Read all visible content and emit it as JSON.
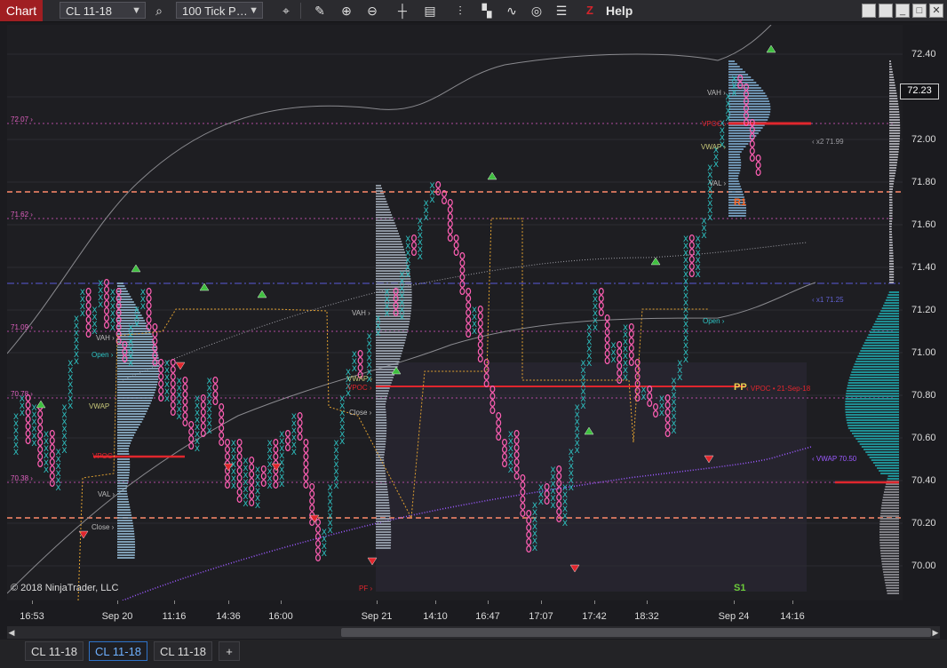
{
  "toolbar": {
    "chart_tab": "Chart",
    "instrument": "CL 11-18",
    "interval": "100 Tick P…",
    "help": "Help",
    "logo_letter": "Z",
    "icons": [
      "search-icon",
      "data-box-icon",
      "pencil-icon",
      "zoom-in-icon",
      "zoom-out-icon",
      "crosshair-icon",
      "chart-properties-icon",
      "bar-type-icon",
      "templates-icon",
      "indicators-icon",
      "strategies-icon",
      "object-list-icon"
    ]
  },
  "window_buttons": [
    "restore-icon",
    "tile-icon",
    "minimize-icon",
    "maximize-icon",
    "close-icon"
  ],
  "chart": {
    "copyright": "© 2018 NinjaTrader, LLC",
    "current_price": "72.23",
    "price_ticks": [
      "72.40",
      "72.20",
      "72.00",
      "71.80",
      "71.60",
      "71.40",
      "71.20",
      "71.00",
      "70.80",
      "70.60",
      "70.40",
      "70.20",
      "70.00"
    ],
    "time_ticks": [
      "16:53",
      "Sep 20",
      "11:16",
      "14:36",
      "16:00",
      "Sep 21",
      "14:10",
      "16:47",
      "17:07",
      "17:42",
      "18:32",
      "Sep 24",
      "14:16"
    ],
    "left_levels": [
      "72.07",
      "71.62",
      "71.09",
      "70.78",
      "70.38"
    ],
    "profile_labels": {
      "vah": "VAH",
      "open": "Open",
      "vwap": "VWAP",
      "vpoc": "VPOC",
      "val": "VAL",
      "close": "Close",
      "pf": "PF",
      "vpoc_naked": "VPOC • 21-Sep-18",
      "vwap_right": "VWAP 70.50",
      "x1": "x1 71.25",
      "x2": "x2 71.99"
    },
    "pivots": {
      "pp": "PP",
      "r1": "R1",
      "s1": "S1"
    },
    "colors": {
      "x": "#2ec4c4",
      "o": "#ff5fb4",
      "vpoc": "#e0262d",
      "dashed": "#ff8a6a",
      "vwap": "#9b59ff",
      "up": "#3fbf3f",
      "down": "#e0262d"
    }
  },
  "tabs": [
    "CL 11-18",
    "CL 11-18",
    "CL 11-18"
  ],
  "add_tab": "+"
}
